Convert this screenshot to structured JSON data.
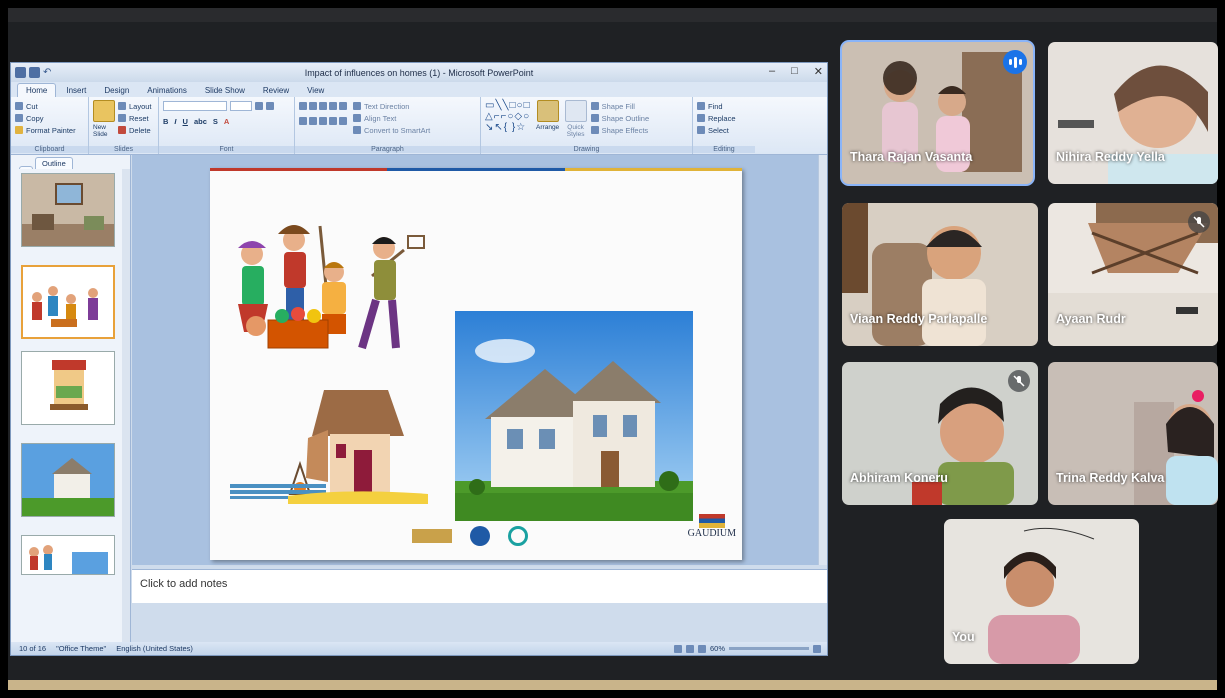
{
  "ppt": {
    "doc_title": "Impact of influences on homes (1) - Microsoft PowerPoint",
    "tabs": [
      "Home",
      "Insert",
      "Design",
      "Animations",
      "Slide Show",
      "Review",
      "View"
    ],
    "clipboard": {
      "cut": "Cut",
      "copy": "Copy",
      "format_painter": "Format Painter",
      "label": "Clipboard"
    },
    "slides": {
      "layout": "Layout",
      "reset": "Reset",
      "new_slide": "New Slide",
      "delete": "Delete",
      "label": "Slides"
    },
    "font_label": "Font",
    "paragraph": {
      "text_direction": "Text Direction",
      "align_text": "Align Text",
      "convert": "Convert to SmartArt",
      "label": "Paragraph"
    },
    "drawing": {
      "arrange": "Arrange",
      "quick_styles": "Quick Styles",
      "shape_fill": "Shape Fill",
      "shape_outline": "Shape Outline",
      "shape_effects": "Shape Effects",
      "label": "Drawing"
    },
    "editing": {
      "find": "Find",
      "replace": "Replace",
      "select": "Select",
      "label": "Editing"
    },
    "pane_tabs": [
      "Outline"
    ],
    "notes_placeholder": "Click to add notes",
    "status": {
      "slide": "10 of 16",
      "theme": "\"Office Theme\"",
      "language": "English (United States)",
      "zoom": "60%"
    },
    "slide_logo": "GAUDIUM"
  },
  "participants": [
    {
      "name": "Thara Rajan Vasanta",
      "speaking": true,
      "muted": false
    },
    {
      "name": "Nihira Reddy Yella",
      "speaking": false,
      "muted": false
    },
    {
      "name": "Viaan Reddy Parlapalle",
      "speaking": false,
      "muted": false
    },
    {
      "name": "Ayaan Rudr",
      "speaking": false,
      "muted": true
    },
    {
      "name": "Abhiram Koneru",
      "speaking": false,
      "muted": true
    },
    {
      "name": "Trina Reddy Kalva",
      "speaking": false,
      "muted": false
    },
    {
      "name": "You",
      "speaking": false,
      "muted": false
    }
  ],
  "colors": {
    "speaking_blue": "#1a73e8",
    "active_border": "#8ab4f8",
    "meet_bg": "#1f2124"
  }
}
